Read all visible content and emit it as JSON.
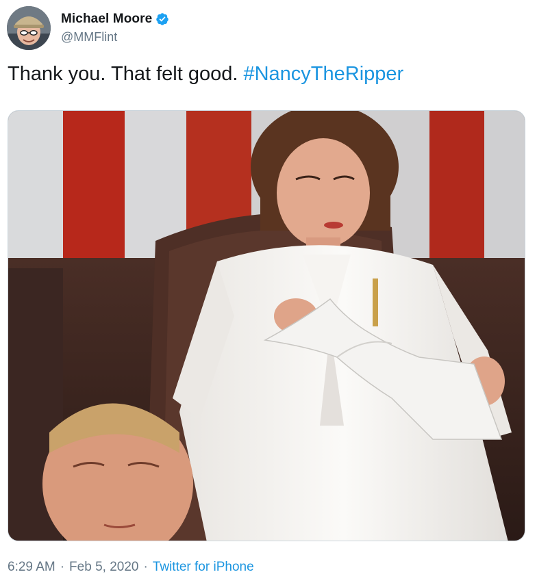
{
  "author": {
    "display_name": "Michael Moore",
    "handle": "@MMFlint",
    "verified": true,
    "avatar_icon": "profile-photo"
  },
  "tweet": {
    "text_plain": "Thank you. That felt good. ",
    "hashtag": "#NancyTheRipper"
  },
  "media": {
    "type": "photo"
  },
  "meta": {
    "time": "6:29 AM",
    "separator": "·",
    "date": "Feb 5, 2020",
    "source": "Twitter for iPhone"
  },
  "colors": {
    "link": "#1b95e0",
    "secondary_text": "#657786",
    "primary_text": "#14171a",
    "verified_badge": "#1da1f2"
  }
}
